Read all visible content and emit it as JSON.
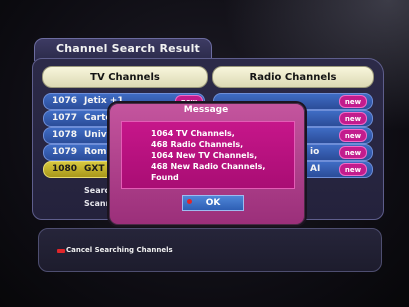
{
  "screen": {
    "title": "Channel Search Result"
  },
  "columns": {
    "tv": "TV Channels",
    "radio": "Radio Channels"
  },
  "tv_rows": [
    {
      "num": "1076",
      "name": "Jetix +1",
      "badge": "new"
    },
    {
      "num": "1077",
      "name": "Carto",
      "badge": ""
    },
    {
      "num": "1078",
      "name": "Unive",
      "badge": ""
    },
    {
      "num": "1079",
      "name": "Roma",
      "badge": ""
    },
    {
      "num": "1080",
      "name": "GXT",
      "badge": ""
    }
  ],
  "radio_rows": [
    {
      "name": "",
      "badge": "new"
    },
    {
      "name": "",
      "badge": "new"
    },
    {
      "name": "",
      "badge": "new"
    },
    {
      "name": "io",
      "badge": "new"
    },
    {
      "name": "AI",
      "badge": "new"
    }
  ],
  "status": {
    "searching": "Search",
    "scanning": "Scann"
  },
  "dialog": {
    "title": "Message",
    "lines": [
      "1064 TV Channels,",
      "468 Radio Channels,",
      "1064 New TV Channels,",
      "468 New Radio Channels,",
      "Found"
    ],
    "ok_label": "OK"
  },
  "footer": {
    "cancel_label": "Cancel Searching Channels",
    "cancel_key_color": "#e0262a"
  }
}
